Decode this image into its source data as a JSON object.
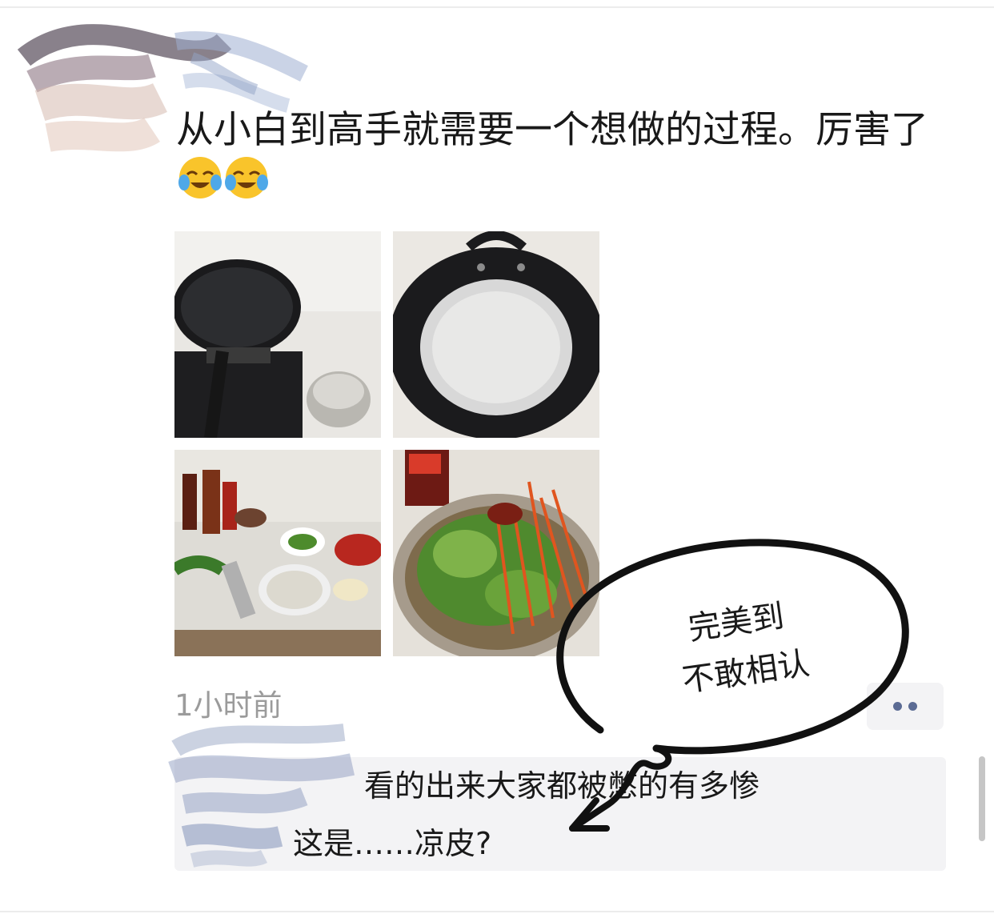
{
  "post": {
    "text": "从小白到高手就需要一个想做的过程。厉害了",
    "emoji": [
      "laughing-crying-face",
      "laughing-crying-face"
    ]
  },
  "photos": [
    "frying-pan-on-stove",
    "rice-batter-in-pan",
    "kitchen-ingredients",
    "mixed-salad-bowl"
  ],
  "meta": {
    "timestamp": "1小时前"
  },
  "comments": [
    {
      "text": "看的出来大家都被憋的有多惨"
    },
    {
      "text": "这是……凉皮?"
    }
  ],
  "annotation": {
    "line1": "完美到",
    "line2": "不敢相认"
  },
  "colors": {
    "more_dots": "#5b6b94",
    "comment_bg": "#f3f3f5",
    "timestamp": "#9b9b9b"
  }
}
